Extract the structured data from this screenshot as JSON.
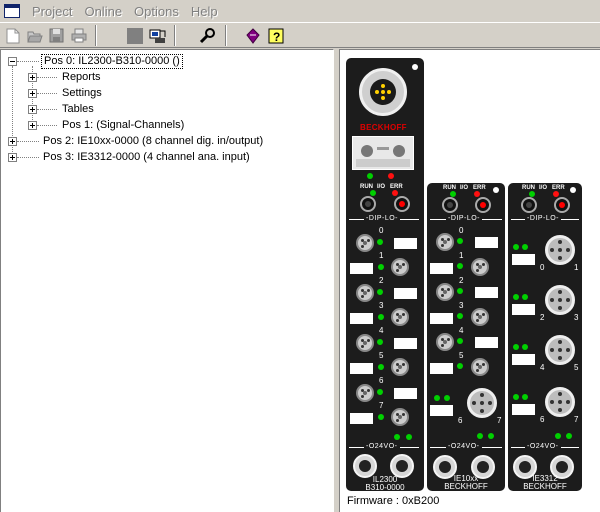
{
  "menu": {
    "items": [
      "Project",
      "Online",
      "Options",
      "Help"
    ]
  },
  "toolbar": {
    "buttons": [
      "new-icon",
      "open-icon",
      "save-icon",
      "print-icon",
      "gray-icon",
      "download-icon",
      "tools-icon",
      "device-icon",
      "help-icon"
    ]
  },
  "tree": {
    "items": [
      {
        "label": "Pos 0: IL2300-B310-0000  ()",
        "level": 0,
        "expanded": true,
        "selected": true
      },
      {
        "label": "Reports",
        "level": 1,
        "expanded": false
      },
      {
        "label": "Settings",
        "level": 1,
        "expanded": false
      },
      {
        "label": "Tables",
        "level": 1,
        "expanded": false
      },
      {
        "label": "Pos 1:   (Signal-Channels)",
        "level": 1,
        "expanded": false
      },
      {
        "label": "Pos 2: IE10xx-0000  (8 channel dig. in/output)",
        "level": 0,
        "expanded": false
      },
      {
        "label": "Pos 3: IE3312-0000  (4 channel ana. input)",
        "level": 0,
        "expanded": false
      }
    ]
  },
  "device": {
    "brand": "BECKHOFF",
    "led_labels": {
      "run": "RUN",
      "io": "I/O",
      "err": "ERR"
    },
    "dip_label": "-DIP-LO-",
    "power_label": "-O24VO-",
    "module1": {
      "name_line1": "IL2300",
      "name_line2": "B310-0000",
      "channels": [
        "0",
        "1",
        "2",
        "3",
        "4",
        "5",
        "6",
        "7"
      ]
    },
    "module2": {
      "name_line1": "IE10xx",
      "name_line2": "BECKHOFF",
      "channels": [
        "0",
        "1",
        "2",
        "3",
        "4",
        "5",
        "6",
        "7"
      ]
    },
    "module3": {
      "name_line1": "IE3312",
      "name_line2": "BECKHOFF",
      "channels": [
        "0",
        "1",
        "2",
        "3",
        "4",
        "5",
        "6",
        "7"
      ]
    },
    "colors": {
      "module": "#1c1c1c",
      "led_green": "#00d000",
      "led_red": "#ff1010",
      "brand_red": "#e00000"
    }
  },
  "status": {
    "firmware": "Firmware : 0xB200"
  }
}
